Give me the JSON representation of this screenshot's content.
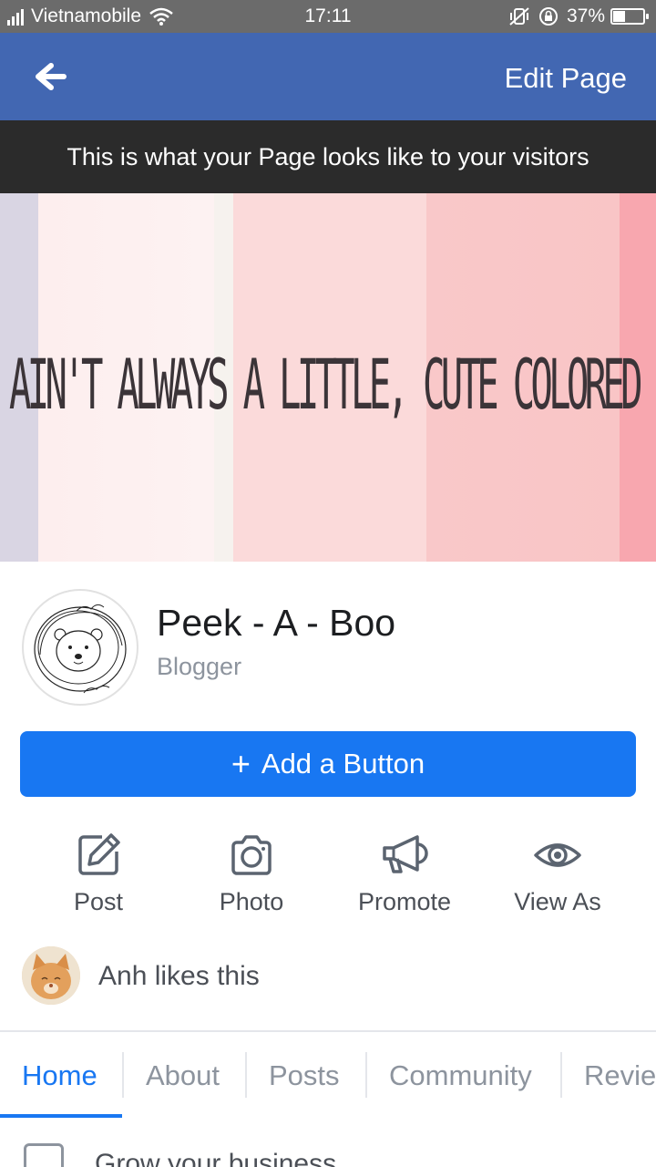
{
  "status_bar": {
    "carrier": "Vietnamobile",
    "time": "17:11",
    "battery": "37%",
    "battery_level": 0.37
  },
  "app_bar": {
    "back_icon": "arrow-left-icon",
    "edit_label": "Edit Page"
  },
  "preview_banner": "This is what your Page looks like to your visitors",
  "cover": {
    "text": "AIN'T ALWAYS A LITTLE, CUTE COLORED FL"
  },
  "profile": {
    "name": "Peek - A - Boo",
    "category": "Blogger"
  },
  "add_button": {
    "icon": "plus-icon",
    "label": "Add a Button"
  },
  "actions": [
    {
      "label": "Post",
      "icon": "edit-icon"
    },
    {
      "label": "Photo",
      "icon": "camera-icon"
    },
    {
      "label": "Promote",
      "icon": "megaphone-icon"
    },
    {
      "label": "View As",
      "icon": "eye-icon"
    }
  ],
  "likes": {
    "text": "Anh likes this"
  },
  "tabs": [
    {
      "label": "Home",
      "active": true
    },
    {
      "label": "About",
      "active": false
    },
    {
      "label": "Posts",
      "active": false
    },
    {
      "label": "Community",
      "active": false
    },
    {
      "label": "Revie",
      "active": false
    }
  ],
  "next_section": {
    "label": "Grow your business"
  },
  "colors": {
    "app_bar": "#4267b2",
    "primary_button": "#1877f2",
    "active_tab": "#1877f2",
    "banner": "#2b2b2b"
  }
}
